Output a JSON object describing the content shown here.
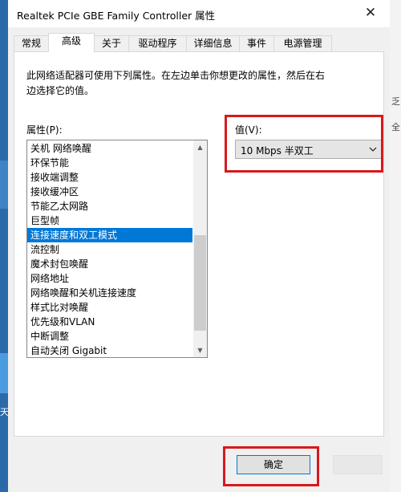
{
  "window": {
    "title": "Realtek PCIe GBE Family Controller 属性",
    "close_glyph": "✕"
  },
  "tabs": [
    {
      "label": "常规"
    },
    {
      "label": "高级"
    },
    {
      "label": "关于"
    },
    {
      "label": "驱动程序"
    },
    {
      "label": "详细信息"
    },
    {
      "label": "事件"
    },
    {
      "label": "电源管理"
    }
  ],
  "active_tab": "高级",
  "panel": {
    "description_line1": "此网络适配器可使用下列属性。在左边单击你想更改的属性，然后在右",
    "description_line2": "边选择它的值。",
    "property_label": "属性(P):",
    "value_label": "值(V):"
  },
  "properties": [
    "关机 网络唤醒",
    "环保节能",
    "接收端调整",
    "接收缓冲区",
    "节能乙太网路",
    "巨型帧",
    "连接速度和双工模式",
    "流控制",
    "魔术封包唤醒",
    "网络地址",
    "网络唤醒和关机连接速度",
    "样式比对唤醒",
    "优先级和VLAN",
    "中断调整",
    "自动关闭 Gigabit"
  ],
  "selected_property": "连接速度和双工模式",
  "value_select": {
    "selected": "10 Mbps 半双工"
  },
  "buttons": {
    "ok": "确定"
  },
  "background_fragments": {
    "left_text": "天",
    "right_text_1": "乏",
    "right_text_2": "全"
  },
  "colors": {
    "accent": "#0078d7",
    "highlight_box": "#d7191c",
    "desktop": "#2b6aa8"
  }
}
